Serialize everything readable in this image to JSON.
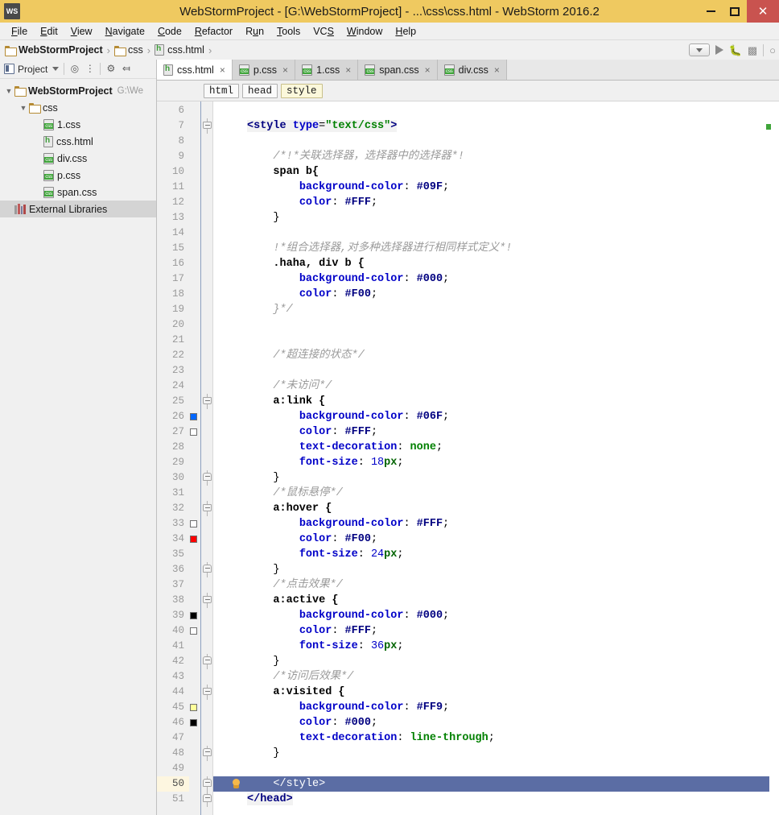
{
  "window": {
    "title": "WebStormProject - [G:\\WebStormProject] - ...\\css\\css.html - WebStorm 2016.2",
    "logo": "WS",
    "accent_titlebar": "#EFC960",
    "close_button_color": "#C9534F",
    "controls": {
      "minimize": "minimize-icon",
      "maximize": "maximize-icon",
      "close": "close-icon"
    }
  },
  "menubar": {
    "items": [
      {
        "label": "File",
        "mnemonic": "F"
      },
      {
        "label": "Edit",
        "mnemonic": "E"
      },
      {
        "label": "View",
        "mnemonic": "V"
      },
      {
        "label": "Navigate",
        "mnemonic": "N"
      },
      {
        "label": "Code",
        "mnemonic": "C"
      },
      {
        "label": "Refactor",
        "mnemonic": "R"
      },
      {
        "label": "Run",
        "mnemonic": "u"
      },
      {
        "label": "Tools",
        "mnemonic": "T"
      },
      {
        "label": "VCS",
        "mnemonic": "S"
      },
      {
        "label": "Window",
        "mnemonic": "W"
      },
      {
        "label": "Help",
        "mnemonic": "H"
      }
    ]
  },
  "navbar": {
    "crumbs": [
      {
        "label": "WebStormProject",
        "icon": "folder-icon",
        "bold": true
      },
      {
        "label": "css",
        "icon": "folder-icon",
        "bold": false
      },
      {
        "label": "css.html",
        "icon": "html-file-icon",
        "bold": false
      }
    ],
    "separator": "›",
    "run_toolbar": [
      {
        "name": "run-configuration-dropdown",
        "icon": "chevron-down-icon"
      },
      {
        "name": "run-button",
        "icon": "play-icon"
      },
      {
        "name": "debug-button",
        "icon": "bug-icon"
      },
      {
        "name": "coverage-button",
        "icon": "coverage-icon"
      },
      {
        "name": "search-everywhere-button",
        "icon": "search-icon"
      }
    ]
  },
  "sidebar": {
    "toolbar": {
      "project_label": "Project",
      "dropdown_icon": "chevron-down-icon",
      "locate_icon": "target-icon",
      "collapse_icon": "collapse-all-icon",
      "settings_icon": "gear-icon",
      "hide_icon": "hide-panel-icon"
    },
    "tree": [
      {
        "label": "WebStormProject",
        "path": "G:\\We",
        "icon": "folder-icon",
        "depth": 0,
        "expanded": true,
        "bold": true,
        "selected": false
      },
      {
        "label": "css",
        "path": "",
        "icon": "folder-icon",
        "depth": 1,
        "expanded": true,
        "bold": false,
        "selected": false
      },
      {
        "label": "1.css",
        "path": "",
        "icon": "css-file-icon",
        "depth": 2,
        "expanded": null,
        "bold": false,
        "selected": false
      },
      {
        "label": "css.html",
        "path": "",
        "icon": "html-file-icon",
        "depth": 2,
        "expanded": null,
        "bold": false,
        "selected": false
      },
      {
        "label": "div.css",
        "path": "",
        "icon": "css-file-icon",
        "depth": 2,
        "expanded": null,
        "bold": false,
        "selected": false
      },
      {
        "label": "p.css",
        "path": "",
        "icon": "css-file-icon",
        "depth": 2,
        "expanded": null,
        "bold": false,
        "selected": false
      },
      {
        "label": "span.css",
        "path": "",
        "icon": "css-file-icon",
        "depth": 2,
        "expanded": null,
        "bold": false,
        "selected": false
      },
      {
        "label": "External Libraries",
        "path": "",
        "icon": "libraries-icon",
        "depth": 0,
        "expanded": null,
        "bold": false,
        "selected": true
      }
    ]
  },
  "editor": {
    "tabs": [
      {
        "label": "css.html",
        "icon": "html-file-icon",
        "active": true,
        "close": "×"
      },
      {
        "label": "p.css",
        "icon": "css-file-icon",
        "active": false,
        "close": "×"
      },
      {
        "label": "1.css",
        "icon": "css-file-icon",
        "active": false,
        "close": "×"
      },
      {
        "label": "span.css",
        "icon": "css-file-icon",
        "active": false,
        "close": "×"
      },
      {
        "label": "div.css",
        "icon": "css-file-icon",
        "active": false,
        "close": "×"
      }
    ],
    "breadcrumbs": [
      {
        "label": "html",
        "highlighted": false
      },
      {
        "label": "head",
        "highlighted": false
      },
      {
        "label": "style",
        "highlighted": true
      }
    ],
    "first_visible_line": 6,
    "last_visible_line": 51,
    "caret_line": 50,
    "selected_line": 50,
    "selection_color": "#5B6DA4",
    "lines": [
      {
        "n": 6,
        "text": ""
      },
      {
        "n": 7,
        "text": "<style type=\"text/css\">"
      },
      {
        "n": 8,
        "text": ""
      },
      {
        "n": 9,
        "text": "    /*!*关联选择器，选择器中的选择器*!"
      },
      {
        "n": 10,
        "text": "    span b{"
      },
      {
        "n": 11,
        "text": "        background-color: #09F;"
      },
      {
        "n": 12,
        "text": "        color: #FFF;"
      },
      {
        "n": 13,
        "text": "    }"
      },
      {
        "n": 14,
        "text": ""
      },
      {
        "n": 15,
        "text": "    !*组合选择器,对多种选择器进行相同样式定义*!"
      },
      {
        "n": 16,
        "text": "    .haha, div b {"
      },
      {
        "n": 17,
        "text": "        background-color: #000;"
      },
      {
        "n": 18,
        "text": "        color: #F00;"
      },
      {
        "n": 19,
        "text": "    }*/"
      },
      {
        "n": 20,
        "text": ""
      },
      {
        "n": 21,
        "text": ""
      },
      {
        "n": 22,
        "text": "    /*超连接的状态*/"
      },
      {
        "n": 23,
        "text": ""
      },
      {
        "n": 24,
        "text": "    /*未访问*/"
      },
      {
        "n": 25,
        "text": "    a:link {"
      },
      {
        "n": 26,
        "text": "        background-color: #06F;"
      },
      {
        "n": 27,
        "text": "        color: #FFF;"
      },
      {
        "n": 28,
        "text": "        text-decoration: none;"
      },
      {
        "n": 29,
        "text": "        font-size: 18px;"
      },
      {
        "n": 30,
        "text": "    }"
      },
      {
        "n": 31,
        "text": "    /*鼠标悬停*/"
      },
      {
        "n": 32,
        "text": "    a:hover {"
      },
      {
        "n": 33,
        "text": "        background-color: #FFF;"
      },
      {
        "n": 34,
        "text": "        color: #F00;"
      },
      {
        "n": 35,
        "text": "        font-size: 24px;"
      },
      {
        "n": 36,
        "text": "    }"
      },
      {
        "n": 37,
        "text": "    /*点击效果*/"
      },
      {
        "n": 38,
        "text": "    a:active {"
      },
      {
        "n": 39,
        "text": "        background-color: #000;"
      },
      {
        "n": 40,
        "text": "        color: #FFF;"
      },
      {
        "n": 41,
        "text": "        font-size: 36px;"
      },
      {
        "n": 42,
        "text": "    }"
      },
      {
        "n": 43,
        "text": "    /*访问后效果*/"
      },
      {
        "n": 44,
        "text": "    a:visited {"
      },
      {
        "n": 45,
        "text": "        background-color: #FF9;"
      },
      {
        "n": 46,
        "text": "        color: #000;"
      },
      {
        "n": 47,
        "text": "        text-decoration: line-through;"
      },
      {
        "n": 48,
        "text": "    }"
      },
      {
        "n": 49,
        "text": ""
      },
      {
        "n": 50,
        "text": "    </style>"
      },
      {
        "n": 51,
        "text": "</head>"
      }
    ],
    "gutter_color_swatches": [
      {
        "line": 26,
        "color": "#0066FF"
      },
      {
        "line": 27,
        "color": "#FFFFFF"
      },
      {
        "line": 33,
        "color": "#FFFFFF"
      },
      {
        "line": 34,
        "color": "#FF0000"
      },
      {
        "line": 39,
        "color": "#000000"
      },
      {
        "line": 40,
        "color": "#FFFFFF"
      },
      {
        "line": 45,
        "color": "#FFFF99"
      },
      {
        "line": 46,
        "color": "#000000"
      }
    ],
    "fold_markers": [
      {
        "line": 7,
        "type": "start"
      },
      {
        "line": 25,
        "type": "start"
      },
      {
        "line": 30,
        "type": "end"
      },
      {
        "line": 32,
        "type": "start"
      },
      {
        "line": 36,
        "type": "end"
      },
      {
        "line": 38,
        "type": "start"
      },
      {
        "line": 42,
        "type": "end"
      },
      {
        "line": 44,
        "type": "start"
      },
      {
        "line": 48,
        "type": "end"
      },
      {
        "line": 50,
        "type": "end"
      },
      {
        "line": 51,
        "type": "end"
      }
    ],
    "intention_bulb": {
      "line": 50,
      "icon": "lightbulb-icon"
    },
    "error_stripe": [
      {
        "color": "#3FA53A",
        "position_ratio": 0.04
      }
    ]
  }
}
